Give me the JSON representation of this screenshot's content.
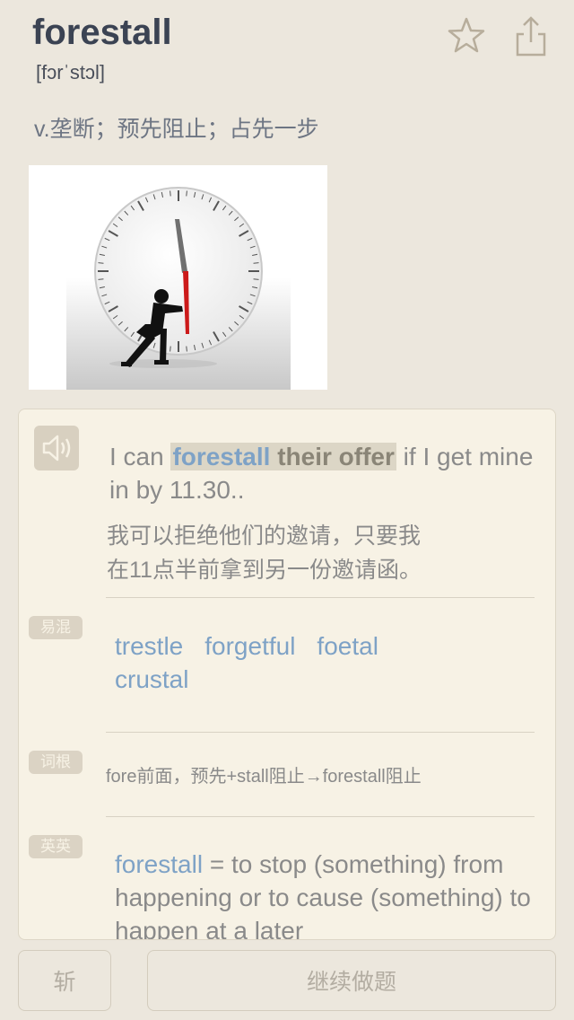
{
  "word": "forestall",
  "phonetic": "[fɔrˈstɔl]",
  "definition": "v.垄断；预先阻止；占先一步",
  "example": {
    "before": "I can ",
    "hl_word": "forestall",
    "hl_rest": "their offer",
    "after": " if I get mine in by 11.30..",
    "translation_line1": "我可以拒绝他们的邀请，只要我",
    "translation_line2": "在11点半前拿到另一份邀请函。"
  },
  "confusable": {
    "tag": "易混",
    "words": [
      "trestle",
      "forgetful",
      "foetal",
      "crustal"
    ]
  },
  "root": {
    "tag": "词根",
    "text": "fore前面，预先+stall阻止→forestall阻止"
  },
  "english": {
    "tag": "英英",
    "word": "forestall",
    "definition": " = to stop (something) from happening or to cause (something) to happen at a later"
  },
  "buttons": {
    "skip": "斩",
    "continue": "继续做题"
  }
}
